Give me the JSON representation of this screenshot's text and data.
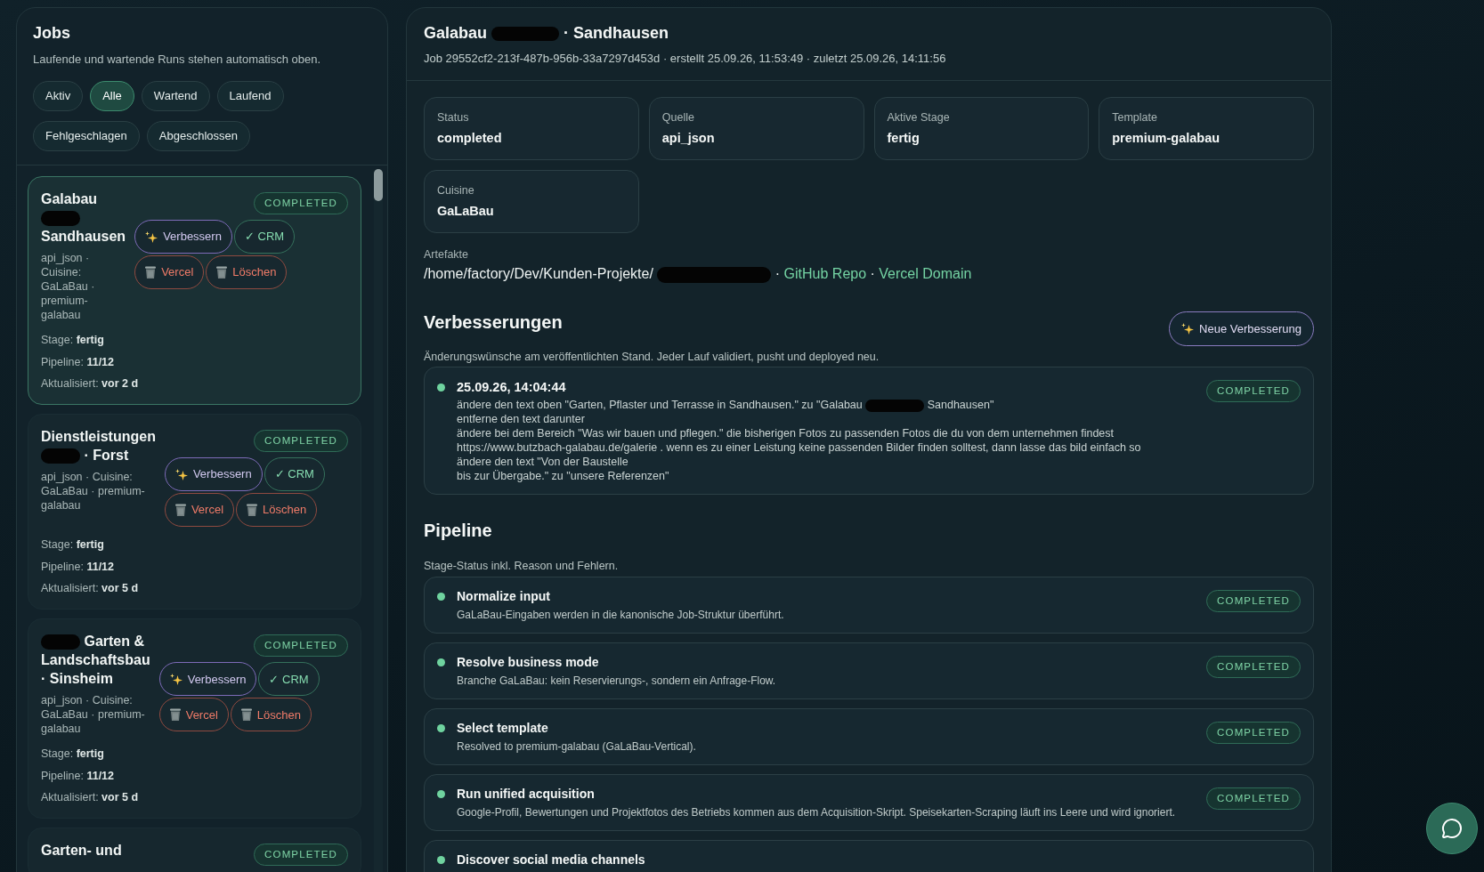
{
  "jobs_panel": {
    "title": "Jobs",
    "subtitle": "Laufende und wartende Runs stehen automatisch oben.",
    "filters": [
      {
        "label": "Aktiv",
        "selected": false
      },
      {
        "label": "Alle",
        "selected": true
      },
      {
        "label": "Wartend",
        "selected": false
      },
      {
        "label": "Laufend",
        "selected": false
      },
      {
        "label": "Fehlgeschlagen",
        "selected": false
      },
      {
        "label": "Abgeschlossen",
        "selected": false
      }
    ],
    "jobs": [
      {
        "selected": true,
        "title": [
          {
            "kind": "text",
            "text": "Galabau"
          },
          {
            "kind": "redacted"
          },
          {
            "kind": "text",
            "text": "Sandhausen"
          }
        ],
        "status": "COMPLETED",
        "meta": "api_json · Cuisine: GaLaBau · premium-galabau",
        "actions": [
          {
            "kind": "improve",
            "label": "Verbessern"
          },
          {
            "kind": "crm",
            "label": "✓ CRM"
          },
          {
            "kind": "delete",
            "label": "Vercel"
          },
          {
            "kind": "delete",
            "label": "Löschen"
          }
        ],
        "stats": [
          "Stage: **fertig**",
          "Pipeline: **11/12**",
          "Aktualisiert: **vor 2 d**"
        ]
      },
      {
        "selected": false,
        "title": [
          {
            "kind": "text",
            "text": "Dienstleistungen"
          },
          {
            "kind": "redacted"
          },
          {
            "kind": "text",
            "text": "· Forst"
          }
        ],
        "status": "COMPLETED",
        "meta": "api_json · Cuisine: GaLaBau · premium-galabau",
        "actions": [
          {
            "kind": "improve",
            "label": "Verbessern"
          },
          {
            "kind": "crm",
            "label": "✓ CRM"
          },
          {
            "kind": "delete",
            "label": "Vercel"
          },
          {
            "kind": "delete",
            "label": "Löschen"
          }
        ],
        "stats": [
          "Stage: **fertig**",
          "Pipeline: **11/12**",
          "Aktualisiert: **vor 5 d**"
        ]
      },
      {
        "selected": false,
        "title": [
          {
            "kind": "redacted"
          },
          {
            "kind": "text",
            "text": "Garten &"
          },
          {
            "kind": "text",
            "text": "Landschaftsbau · Sinsheim"
          }
        ],
        "status": "COMPLETED",
        "meta": "api_json · Cuisine: GaLaBau · premium-galabau",
        "actions": [
          {
            "kind": "improve",
            "label": "Verbessern"
          },
          {
            "kind": "crm",
            "label": "✓ CRM"
          },
          {
            "kind": "delete",
            "label": "Vercel"
          },
          {
            "kind": "delete",
            "label": "Löschen"
          }
        ],
        "stats": [
          "Stage: **fertig**",
          "Pipeline: **11/12**",
          "Aktualisiert: **vor 5 d**"
        ]
      },
      {
        "selected": false,
        "title": [
          {
            "kind": "text",
            "text": "Garten- und"
          }
        ],
        "status": "COMPLETED"
      }
    ]
  },
  "detail": {
    "title": [
      {
        "kind": "text",
        "text": "Galabau"
      },
      {
        "kind": "redacted"
      },
      {
        "kind": "text",
        "text": "· Sandhausen"
      }
    ],
    "meta": "Job 29552cf2-213f-487b-956b-33a7297d453d · erstellt 25.09.26, 11:53:49 · zuletzt 25.09.26, 14:11:56",
    "stats": [
      {
        "label": "Status",
        "value": "completed"
      },
      {
        "label": "Quelle",
        "value": "api_json"
      },
      {
        "label": "Aktive Stage",
        "value": "fertig"
      },
      {
        "label": "Template",
        "value": "premium-galabau"
      },
      {
        "label": "Cuisine",
        "value": "GaLaBau"
      }
    ],
    "artifacts": {
      "label": "Artefakte",
      "parts": [
        {
          "kind": "text",
          "text": "/home/factory/Dev/Kunden-Projekte/"
        },
        {
          "kind": "redacted"
        },
        {
          "kind": "text",
          "text": "·"
        },
        {
          "kind": "link",
          "text": "GitHub Repo"
        },
        {
          "kind": "text",
          "text": "·"
        },
        {
          "kind": "link",
          "text": "Vercel Domain"
        }
      ]
    },
    "improvements": {
      "title": "Verbesserungen",
      "button": "Neue Verbesserung",
      "subtitle": "Änderungswünsche am veröffentlichten Stand. Jeder Lauf validiert, pusht und deployed neu.",
      "items": [
        {
          "time": "25.09.26, 14:04:44",
          "status": "COMPLETED",
          "lines": [
            [
              {
                "kind": "text",
                "text": "ändere den text oben \"Garten, Pflaster und Terrasse in Sandhausen.\" zu \"Galabau"
              },
              {
                "kind": "redacted"
              },
              {
                "kind": "text",
                "text": "Sandhausen\""
              }
            ],
            [
              {
                "kind": "text",
                "text": "entferne den text darunter"
              }
            ],
            [
              {
                "kind": "text",
                "text": "ändere bei dem Bereich \"Was wir bauen und pflegen.\" die bisherigen Fotos zu passenden Fotos die du von dem unternehmen findest"
              }
            ],
            [
              {
                "kind": "text",
                "text": "https://www.butzbach-galabau.de/galerie . wenn es zu einer Leistung keine passenden Bilder finden solltest, dann lasse das bild einfach so"
              }
            ],
            [
              {
                "kind": "text",
                "text": "ändere den text \"Von der Baustelle"
              }
            ],
            [
              {
                "kind": "text",
                "text": "bis zur Übergabe.\" zu \"unsere Referenzen\""
              }
            ]
          ]
        }
      ]
    },
    "pipeline": {
      "title": "Pipeline",
      "subtitle": "Stage-Status inkl. Reason und Fehlern.",
      "stages": [
        {
          "name": "Normalize input",
          "detail": "GaLaBau-Eingaben werden in die kanonische Job-Struktur überführt.",
          "status": "COMPLETED"
        },
        {
          "name": "Resolve business mode",
          "detail": "Branche GaLaBau: kein Reservierungs-, sondern ein Anfrage-Flow.",
          "status": "COMPLETED"
        },
        {
          "name": "Select template",
          "detail": "Resolved to premium-galabau (GaLaBau-Vertical).",
          "status": "COMPLETED"
        },
        {
          "name": "Run unified acquisition",
          "detail": "Google-Profil, Bewertungen und Projektfotos des Betriebs kommen aus dem Acquisition-Skript. Speisekarten-Scraping läuft ins Leere und wird ignoriert.",
          "status": "COMPLETED"
        },
        {
          "name": "Discover social media channels"
        }
      ]
    }
  }
}
